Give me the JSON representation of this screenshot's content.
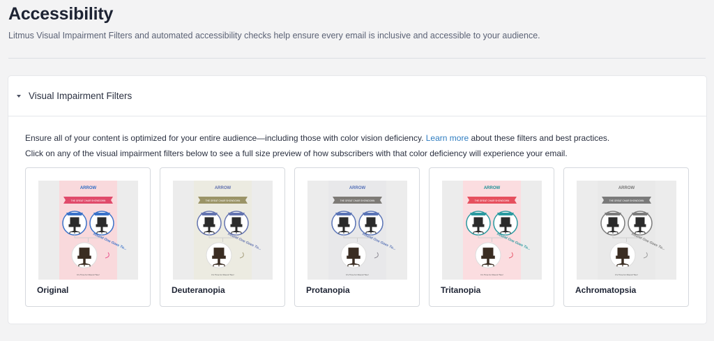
{
  "page": {
    "title": "Accessibility",
    "subtitle": "Litmus Visual Impairment Filters and automated accessibility checks help ensure every email is inclusive and accessible to your audience."
  },
  "section": {
    "title": "Visual Impairment Filters",
    "intro_before_link": "Ensure all of your content is optimized for your entire audience—including those with color vision deficiency. ",
    "intro_link": "Learn more",
    "intro_after_link": " about these filters and best practices.",
    "instruction": "Click on any of the visual impairment filters below to see a full size preview of how subscribers with that color deficiency will experience your email."
  },
  "thumbnail_text": {
    "brand": "ARROW",
    "banner": "THE GREAT CHAIR SHOWDOWN",
    "round_text": "Round One Goes To...",
    "footer": "It's Time for Round Two!"
  },
  "filters": [
    {
      "label": "Original",
      "bg": "#f9d9dc",
      "banner": "#e04a6a",
      "brand": "#2f6cc4",
      "circle": "#3b72c9",
      "accent": "#e8518a"
    },
    {
      "label": "Deuteranopia",
      "bg": "#ecebe1",
      "banner": "#9b9467",
      "brand": "#5f6fae",
      "circle": "#6474b0",
      "accent": "#a39c7a"
    },
    {
      "label": "Protanopia",
      "bg": "#e8e8ea",
      "banner": "#7d7a76",
      "brand": "#5571b8",
      "circle": "#5a74b6",
      "accent": "#8a8790"
    },
    {
      "label": "Tritanopia",
      "bg": "#fbdde0",
      "banner": "#e6505e",
      "brand": "#1d8f96",
      "circle": "#2a9aa0",
      "accent": "#e7566a"
    },
    {
      "label": "Achromatopsia",
      "bg": "#e9e9e9",
      "banner": "#7a7a7a",
      "brand": "#767676",
      "circle": "#7c7c7c",
      "accent": "#9a9a9a"
    }
  ]
}
